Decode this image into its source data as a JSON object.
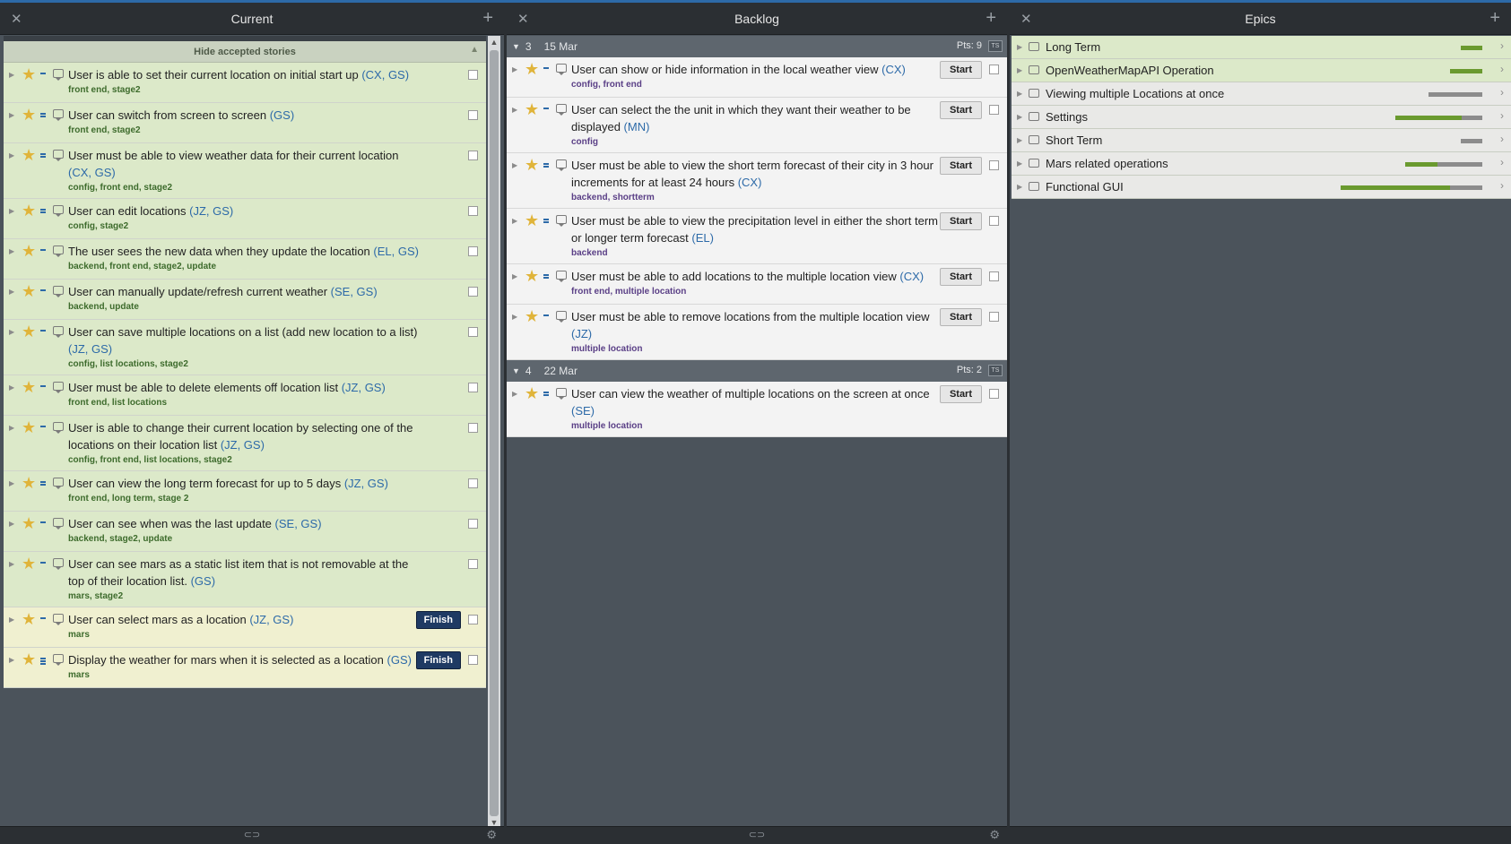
{
  "current": {
    "title": "Current",
    "hide_label": "Hide accepted stories",
    "stories": [
      {
        "title": "User is able to set their current location on initial start up",
        "owners": "(CX, GS)",
        "labels": "front end, stage2",
        "state": "accepted",
        "est": 1
      },
      {
        "title": "User can switch from screen to screen",
        "owners": "(GS)",
        "labels": "front end, stage2",
        "state": "accepted",
        "est": 2
      },
      {
        "title": "User must be able to view weather data for their current location ",
        "owners": "(CX, GS)",
        "labels": "config, front end, stage2",
        "state": "accepted",
        "est": 2
      },
      {
        "title": "User can edit locations",
        "owners": "(JZ, GS)",
        "labels": "config, stage2",
        "state": "accepted",
        "est": 2
      },
      {
        "title": "The user sees the new data when they update the location",
        "owners": "(EL, GS)",
        "labels": "backend, front end, stage2, update",
        "state": "accepted",
        "est": 1
      },
      {
        "title": "User can manually update/refresh current weather",
        "owners": "(SE, GS)",
        "labels": "backend, update",
        "state": "accepted",
        "est": 1
      },
      {
        "title": "User can save multiple locations on a list (add new location to a list)",
        "owners": "(JZ, GS)",
        "labels": "config, list locations, stage2",
        "state": "accepted",
        "est": 1
      },
      {
        "title": "User must be able to delete elements off location list",
        "owners": "(JZ, GS)",
        "labels": "front end, list locations",
        "state": "accepted",
        "est": 1
      },
      {
        "title": "User is able to change their current location by selecting one of the locations on their location list",
        "owners": "(JZ, GS)",
        "labels": "config, front end, list locations, stage2",
        "state": "accepted",
        "est": 1
      },
      {
        "title": "User can view the long term forecast for up to 5 days",
        "owners": "(JZ, GS)",
        "labels": "front end, long term, stage 2",
        "state": "accepted",
        "est": 2
      },
      {
        "title": "User can see when was the last update",
        "owners": "(SE, GS)",
        "labels": "backend, stage2, update",
        "state": "accepted",
        "est": 1
      },
      {
        "title": "User can see mars as a static list item that is not removable at the top of their location list. ",
        "owners": "(GS)",
        "labels": "mars, stage2",
        "state": "accepted",
        "est": 1
      },
      {
        "title": "User can select mars as a location",
        "owners": "(JZ, GS)",
        "labels": "mars",
        "state": "delivered",
        "est": 1,
        "button": "Finish"
      },
      {
        "title": "Display the weather for mars when it is selected as a location",
        "owners": "(GS)",
        "labels": "mars",
        "state": "delivered",
        "est": 3,
        "button": "Finish"
      }
    ]
  },
  "backlog": {
    "title": "Backlog",
    "iterations": [
      {
        "num": "3",
        "date": "15 Mar",
        "pts": "Pts: 9",
        "ts": "TS",
        "stories": [
          {
            "title": "User can show or hide information in the local weather view",
            "owners": "(CX)",
            "labels": "config, front end",
            "est": 1,
            "button": "Start"
          },
          {
            "title": "User can select the the unit in which they want their weather to be displayed",
            "owners": "(MN)",
            "labels": "config",
            "est": 1,
            "button": "Start"
          },
          {
            "title": "User must be able to view the short term forecast of their city in 3 hour increments for at least 24 hours",
            "owners": "(CX)",
            "labels": "backend, shortterm",
            "est": 2,
            "button": "Start"
          },
          {
            "title": "User must be able to view the precipitation level in either the short term or longer term forecast  ",
            "owners": "(EL)",
            "labels": "backend",
            "est": 2,
            "button": "Start"
          },
          {
            "title": "User must be able to add locations to the multiple location view",
            "owners": "(CX)",
            "labels": "front end, multiple location",
            "est": 2,
            "button": "Start"
          },
          {
            "title": "User must be able to remove locations from the multiple location view",
            "owners": "(JZ)",
            "labels": "multiple location",
            "est": 1,
            "button": "Start"
          }
        ]
      },
      {
        "num": "4",
        "date": "22 Mar",
        "pts": "Pts: 2",
        "ts": "TS",
        "stories": [
          {
            "title": "User can view the weather of multiple locations on the screen at once",
            "owners": "(SE)",
            "labels": "multiple location",
            "est": 2,
            "button": "Start"
          }
        ]
      }
    ]
  },
  "epics": {
    "title": "Epics",
    "items": [
      {
        "name": "Long Term",
        "style": "green",
        "progress": 1.0,
        "bar_width": 24
      },
      {
        "name": "OpenWeatherMapAPI Operation",
        "style": "green",
        "progress": 1.0,
        "bar_width": 36
      },
      {
        "name": "Viewing multiple Locations at once",
        "style": "grey",
        "progress": 0.0,
        "bar_width": 60
      },
      {
        "name": "Settings",
        "style": "grey",
        "progress": 0.76,
        "bar_width": 97
      },
      {
        "name": "Short Term",
        "style": "grey",
        "progress": 0.0,
        "bar_width": 24
      },
      {
        "name": "Mars related operations",
        "style": "grey",
        "progress": 0.42,
        "bar_width": 86
      },
      {
        "name": "Functional GUI",
        "style": "grey",
        "progress": 0.77,
        "bar_width": 158
      }
    ]
  },
  "icons": {
    "close": "close-icon",
    "add": "plus-icon",
    "link": "link-icon",
    "settings": "gear-icon"
  }
}
